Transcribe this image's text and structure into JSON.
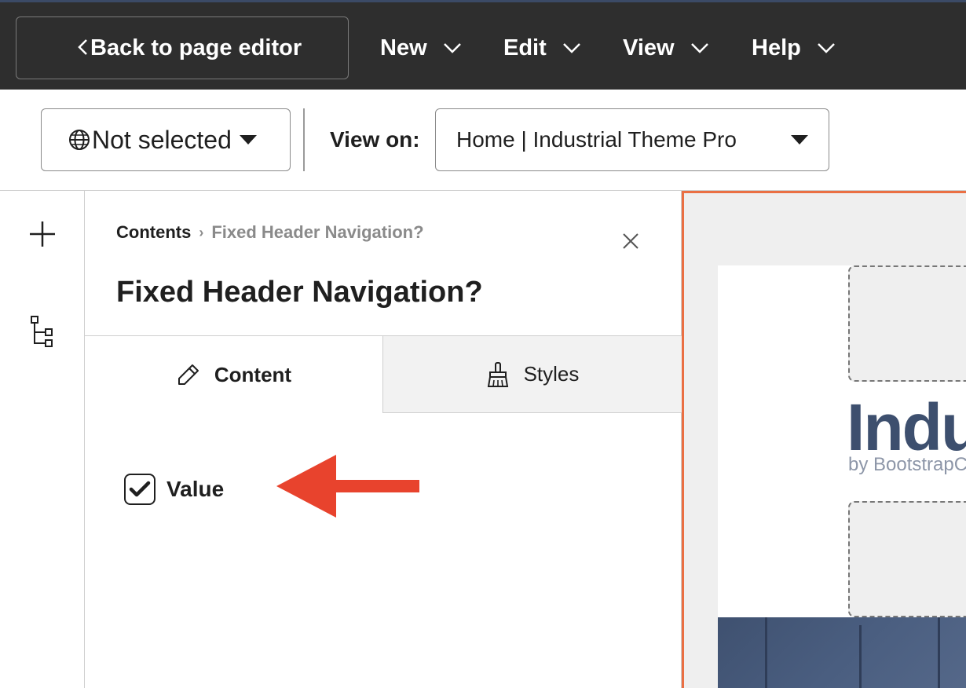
{
  "topbar": {
    "back_label": "Back to page editor",
    "menus": [
      "New",
      "Edit",
      "View",
      "Help"
    ]
  },
  "subbar": {
    "language_label": "Not selected",
    "view_on_label": "View on:",
    "view_on_value": "Home | Industrial Theme Pro"
  },
  "panel": {
    "breadcrumb_root": "Contents",
    "breadcrumb_current": "Fixed Header Navigation?",
    "title": "Fixed Header Navigation?",
    "tabs": [
      {
        "label": "Content",
        "icon": "pencil-icon",
        "active": true
      },
      {
        "label": "Styles",
        "icon": "brush-icon",
        "active": false
      }
    ],
    "checkbox": {
      "label": "Value",
      "checked": true
    }
  },
  "preview": {
    "logo_text": "Indu",
    "logo_subtext": "by BootstrapC"
  },
  "colors": {
    "topbar_bg": "#2e2e2e",
    "preview_border": "#ea6f43",
    "arrow": "#e8432d",
    "logo": "#3d4f6e"
  }
}
